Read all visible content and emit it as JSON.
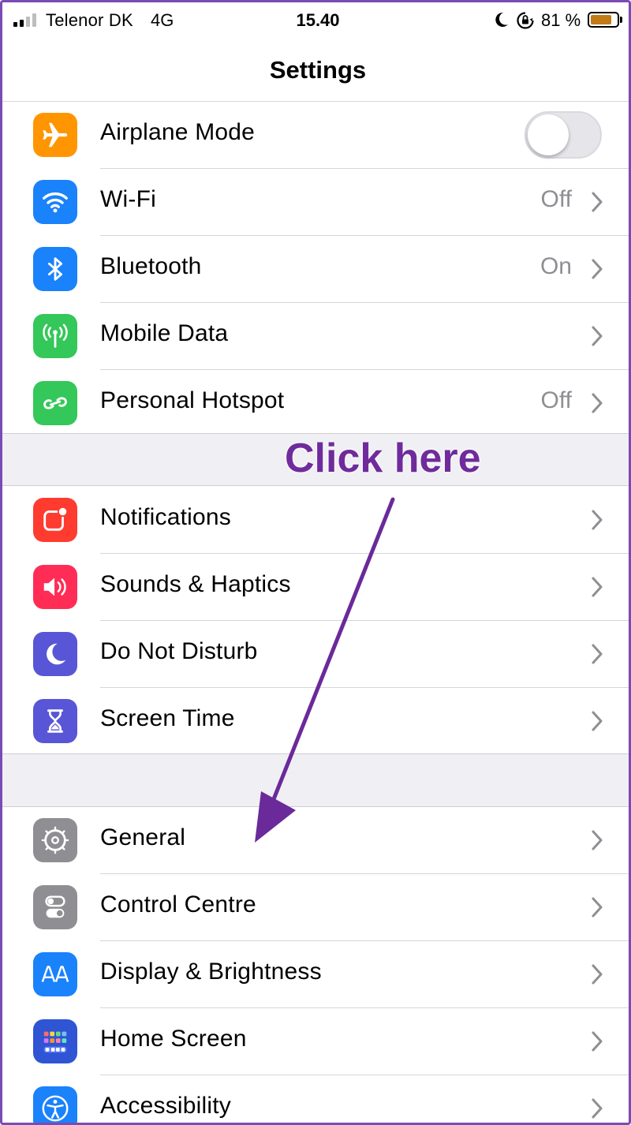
{
  "status_bar": {
    "carrier": "Telenor DK",
    "network": "4G",
    "time": "15.40",
    "battery_percent": "81 %",
    "battery_level": 0.81,
    "icons": [
      "signal-icon",
      "moon-icon",
      "orientation-lock-icon",
      "battery-icon"
    ]
  },
  "nav": {
    "title": "Settings"
  },
  "sections": [
    [
      {
        "label": "Airplane Mode",
        "icon": "airplane-icon",
        "color": "#ff9500",
        "toggle": false
      },
      {
        "label": "Wi-Fi",
        "icon": "wifi-icon",
        "color": "#1a82fb",
        "value": "Off"
      },
      {
        "label": "Bluetooth",
        "icon": "bluetooth-icon",
        "color": "#1a82fb",
        "value": "On"
      },
      {
        "label": "Mobile Data",
        "icon": "antenna-icon",
        "color": "#34c759",
        "value": ""
      },
      {
        "label": "Personal Hotspot",
        "icon": "hotspot-icon",
        "color": "#34c759",
        "value": "Off"
      }
    ],
    [
      {
        "label": "Notifications",
        "icon": "notifications-icon",
        "color": "#ff3b30"
      },
      {
        "label": "Sounds & Haptics",
        "icon": "speaker-icon",
        "color": "#ff2d55"
      },
      {
        "label": "Do Not Disturb",
        "icon": "moon-icon",
        "color": "#5856d6"
      },
      {
        "label": "Screen Time",
        "icon": "hourglass-icon",
        "color": "#5856d6"
      }
    ],
    [
      {
        "label": "General",
        "icon": "gear-icon",
        "color": "#8e8e93"
      },
      {
        "label": "Control Centre",
        "icon": "switches-icon",
        "color": "#8e8e93"
      },
      {
        "label": "Display & Brightness",
        "icon": "text-size-icon",
        "color": "#1a82fb"
      },
      {
        "label": "Home Screen",
        "icon": "home-screen-grid-icon",
        "color": "#2f55d4"
      },
      {
        "label": "Accessibility",
        "icon": "accessibility-icon",
        "color": "#1a82fb"
      }
    ]
  ],
  "annotation": {
    "text": "Click here",
    "color": "#6f2b9c"
  },
  "colors": {
    "frame": "#7a4bb5",
    "group_background": "#efeff4",
    "secondary_text": "#8e8e93"
  }
}
